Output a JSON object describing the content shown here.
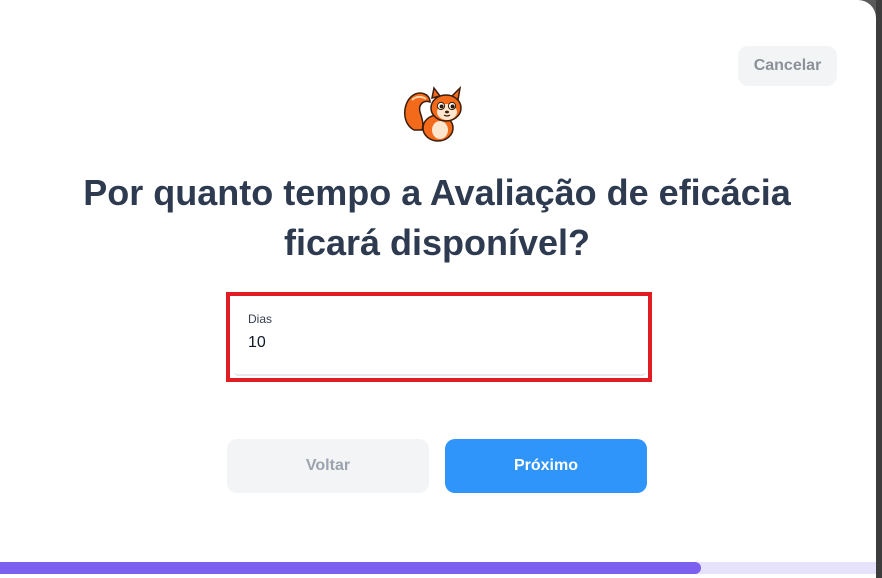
{
  "modal": {
    "cancel_label": "Cancelar",
    "logo_icon": "squirrel-mascot-icon",
    "title": "Por quanto tempo a Avaliação de eficácia ficará disponível?",
    "field": {
      "label": "Dias",
      "value": "10"
    },
    "back_label": "Voltar",
    "next_label": "Próximo",
    "progress_fraction": 0.8
  },
  "colors": {
    "primary": "#2f95fb",
    "progress": "#7b61ee",
    "highlight": "#e11d24",
    "title": "#2d3a4f"
  }
}
